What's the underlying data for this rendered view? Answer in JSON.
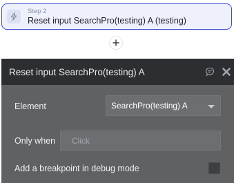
{
  "step": {
    "label": "Step 2",
    "title": "Reset input SearchPro(testing) A (testing)",
    "icon": "lightning-bolt-icon",
    "accent": "#3a46d4"
  },
  "add_step": {
    "icon": "plus-icon"
  },
  "panel": {
    "title": "Reset input SearchPro(testing) A",
    "comment_icon": "comment-icon",
    "close_icon": "close-icon",
    "header_bg": "#2c2e31",
    "body_bg": "#5f6163",
    "element": {
      "label": "Element",
      "value": "SearchPro(testing) A"
    },
    "only_when": {
      "label": "Only when",
      "placeholder": "Click"
    },
    "debug": {
      "label": "Add a breakpoint in debug mode",
      "checked": false
    }
  }
}
